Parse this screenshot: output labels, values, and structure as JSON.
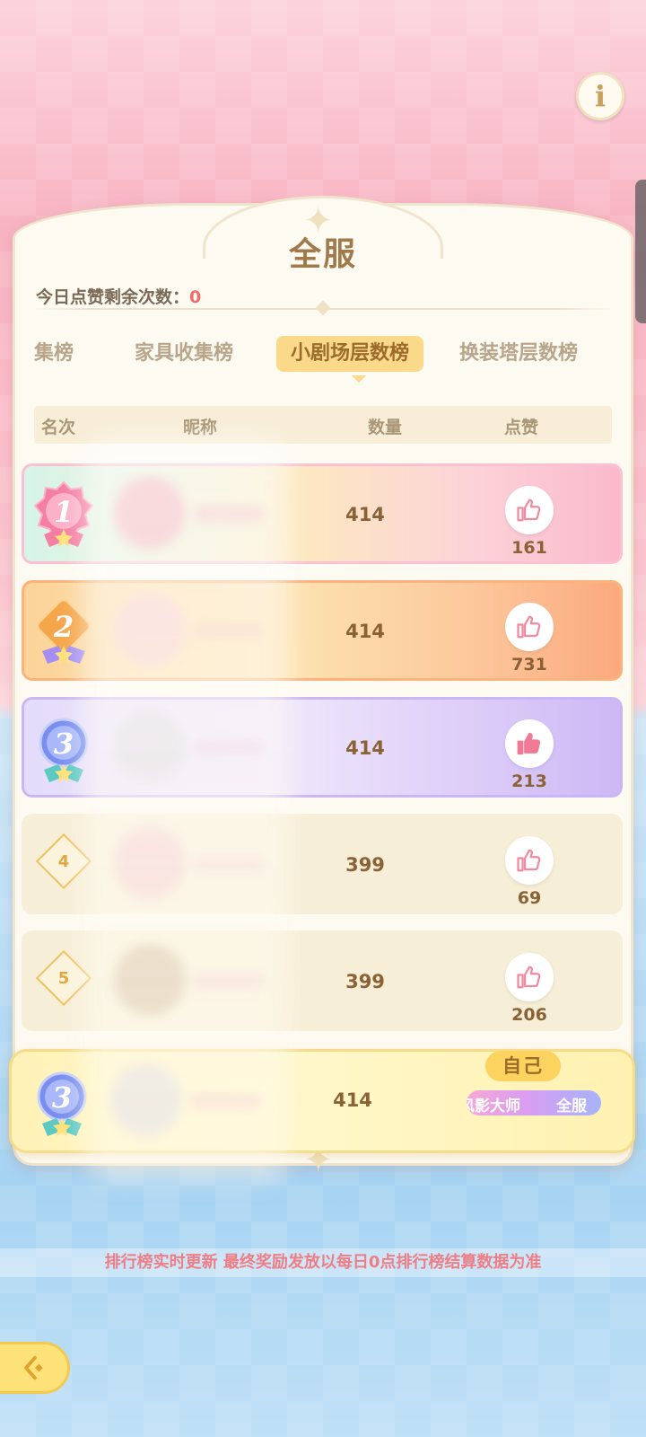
{
  "panel": {
    "title": "全服",
    "likes_remaining_label": "今日点赞剩余次数：",
    "likes_remaining_value": "0"
  },
  "tabs": [
    {
      "label": "集榜",
      "active": false
    },
    {
      "label": "家具收集榜",
      "active": false
    },
    {
      "label": "小剧场层数榜",
      "active": true
    },
    {
      "label": "换装塔层数榜",
      "active": false
    }
  ],
  "table_headers": {
    "rank": "名次",
    "nickname": "昵称",
    "count": "数量",
    "like": "点赞"
  },
  "rows": [
    {
      "rank": "1",
      "count": "414",
      "likes": "161",
      "liked": false
    },
    {
      "rank": "2",
      "count": "414",
      "likes": "731",
      "liked": false
    },
    {
      "rank": "3",
      "count": "414",
      "likes": "213",
      "liked": true
    },
    {
      "rank": "4",
      "count": "399",
      "likes": "69",
      "liked": false
    },
    {
      "rank": "5",
      "count": "399",
      "likes": "206",
      "liked": false
    }
  ],
  "self": {
    "tag": "自己",
    "rank": "3",
    "count": "414",
    "title_part1": "风影大师",
    "title_part2": "全服"
  },
  "notice": "排行榜实时更新 最终奖励发放以每日0点排行榜结算数据为准",
  "icons": {
    "info": "info-icon",
    "back": "back-arrow-icon",
    "like": "thumbs-up-icon"
  },
  "colors": {
    "accent": "#fbd98a",
    "like": "#f08aa0",
    "notice": "#ee7e86"
  }
}
